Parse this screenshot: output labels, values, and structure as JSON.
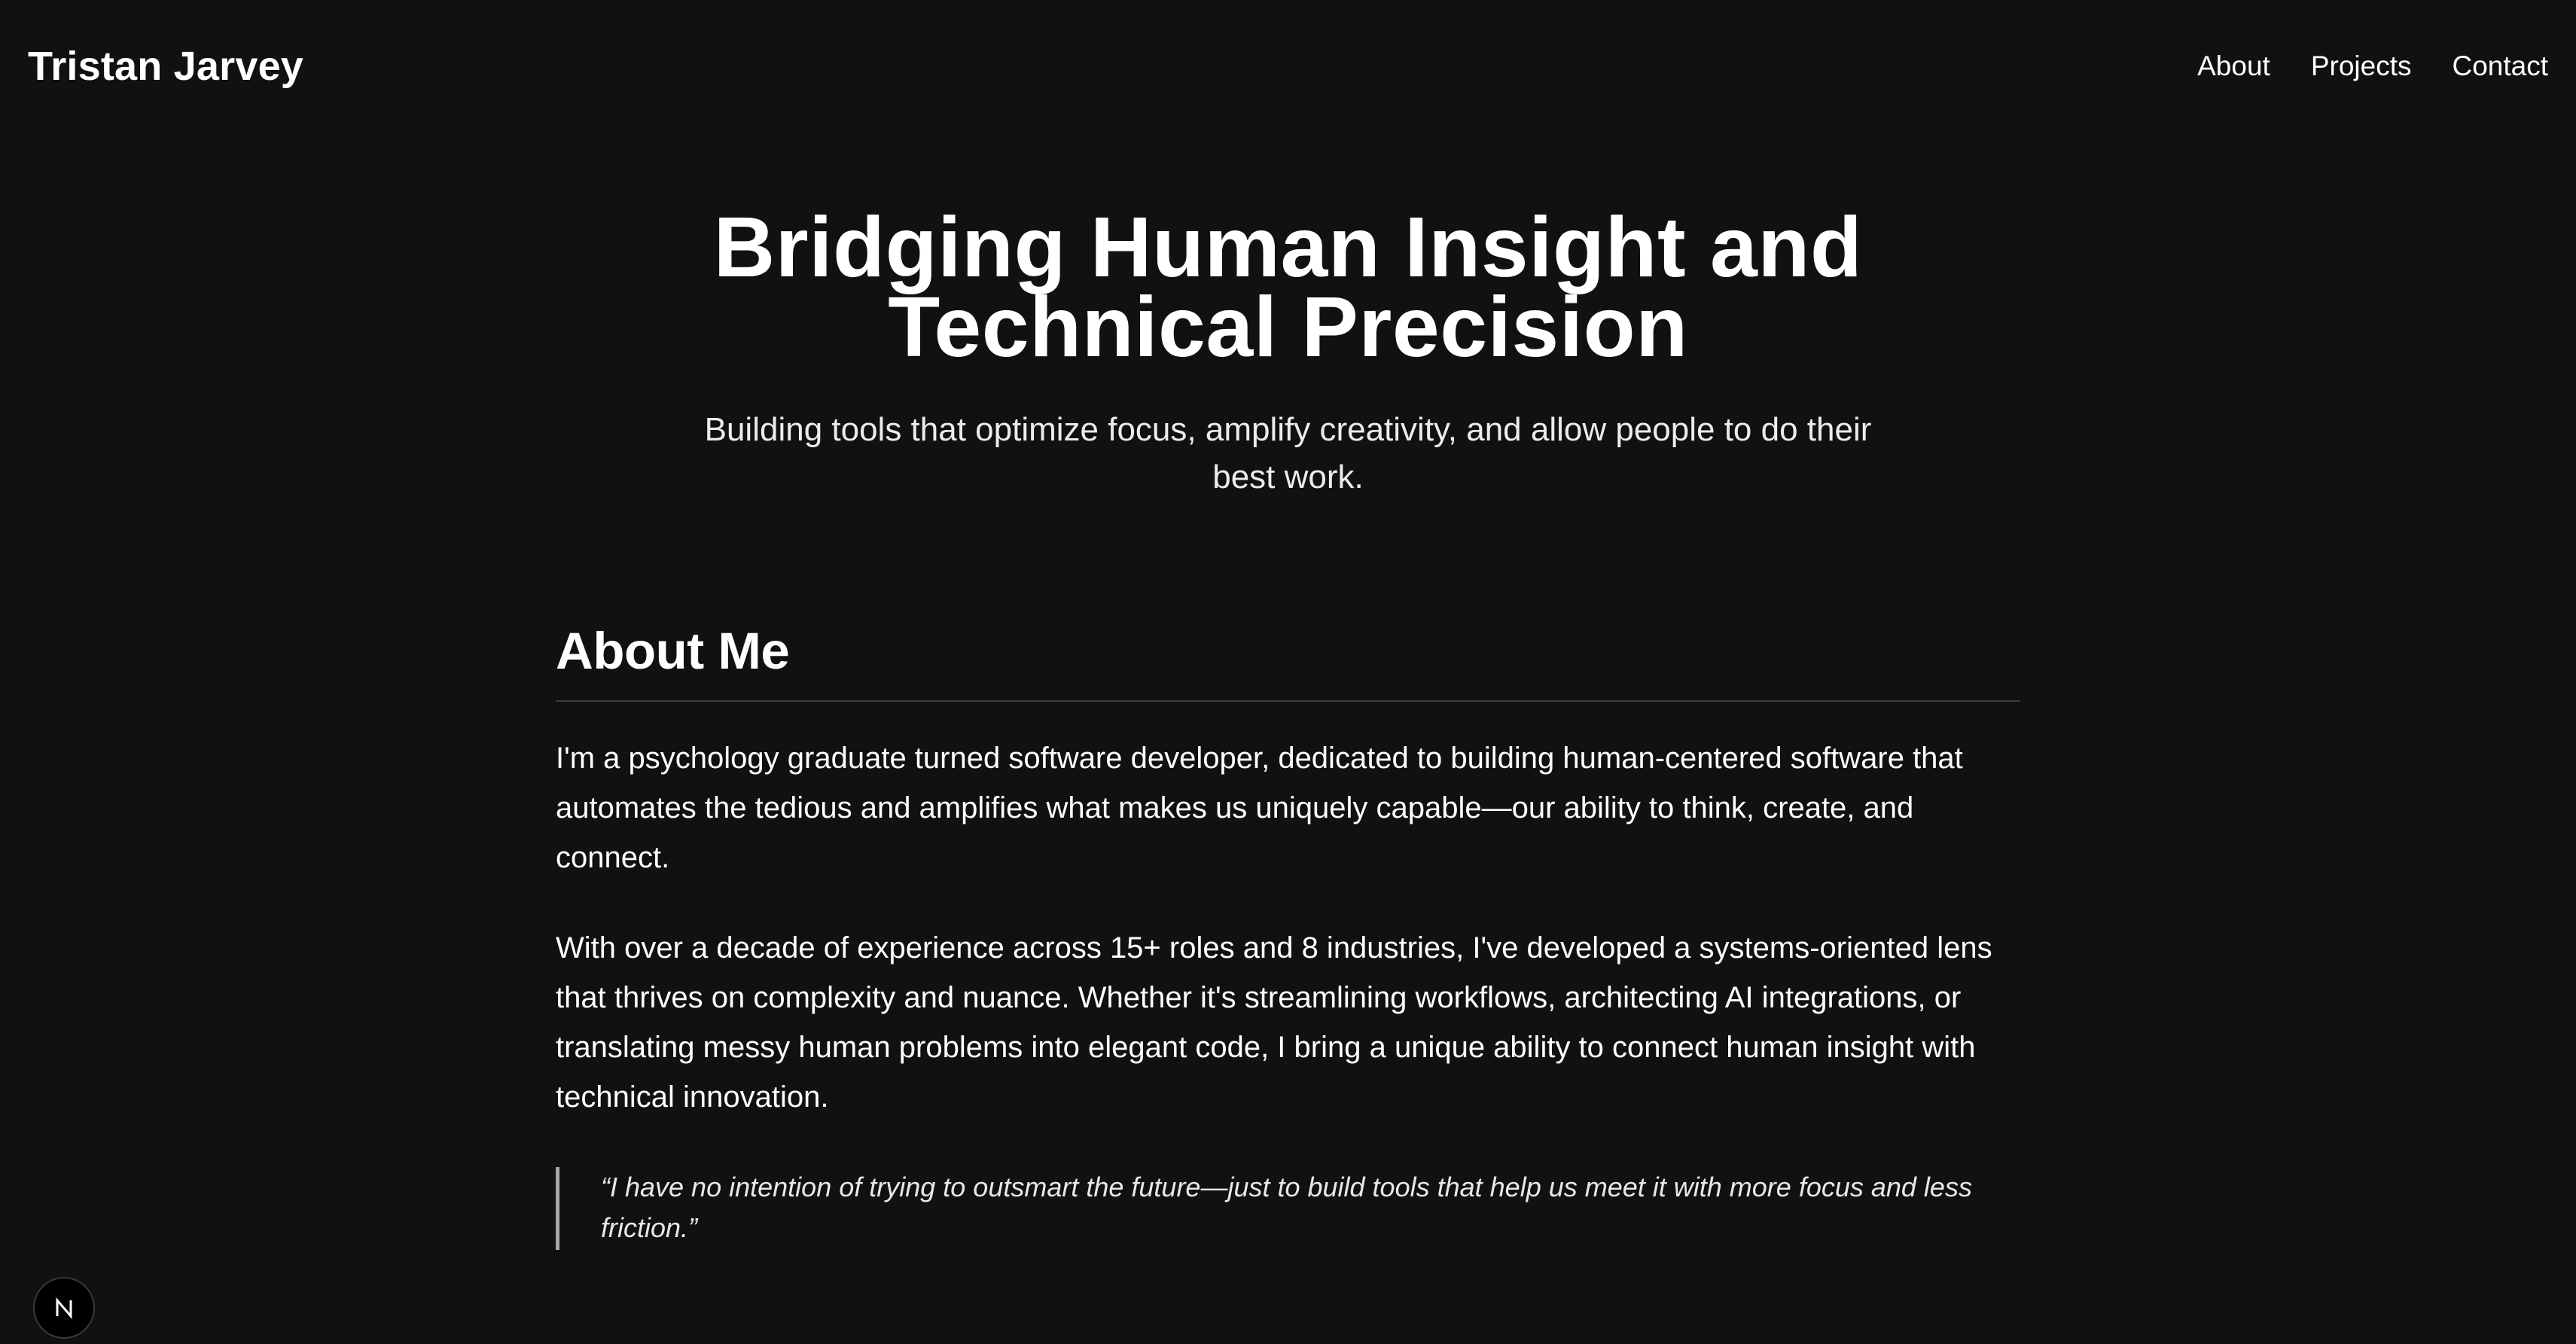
{
  "header": {
    "brand": "Tristan Jarvey",
    "nav": [
      {
        "label": "About"
      },
      {
        "label": "Projects"
      },
      {
        "label": "Contact"
      }
    ]
  },
  "hero": {
    "title": "Bridging Human Insight and Technical Precision",
    "subtitle": "Building tools that optimize focus, amplify creativity, and allow people to do their best work."
  },
  "about": {
    "heading": "About Me",
    "paragraph1": "I'm a psychology graduate turned software developer, dedicated to building human-centered software that automates the tedious and amplifies what makes us uniquely capable—our ability to think, create, and connect.",
    "paragraph2": "With over a decade of experience across 15+ roles and 8 industries, I've developed a systems-oriented lens that thrives on complexity and nuance. Whether it's streamlining workflows, architecting AI integrations, or translating messy human problems into elegant code, I bring a unique ability to connect human insight with technical innovation.",
    "quote": "“I have no intention of trying to outsmart the future—just to build tools that help us meet it with more focus and less friction.”"
  },
  "dev_badge": {
    "icon": "n-logo-icon"
  }
}
